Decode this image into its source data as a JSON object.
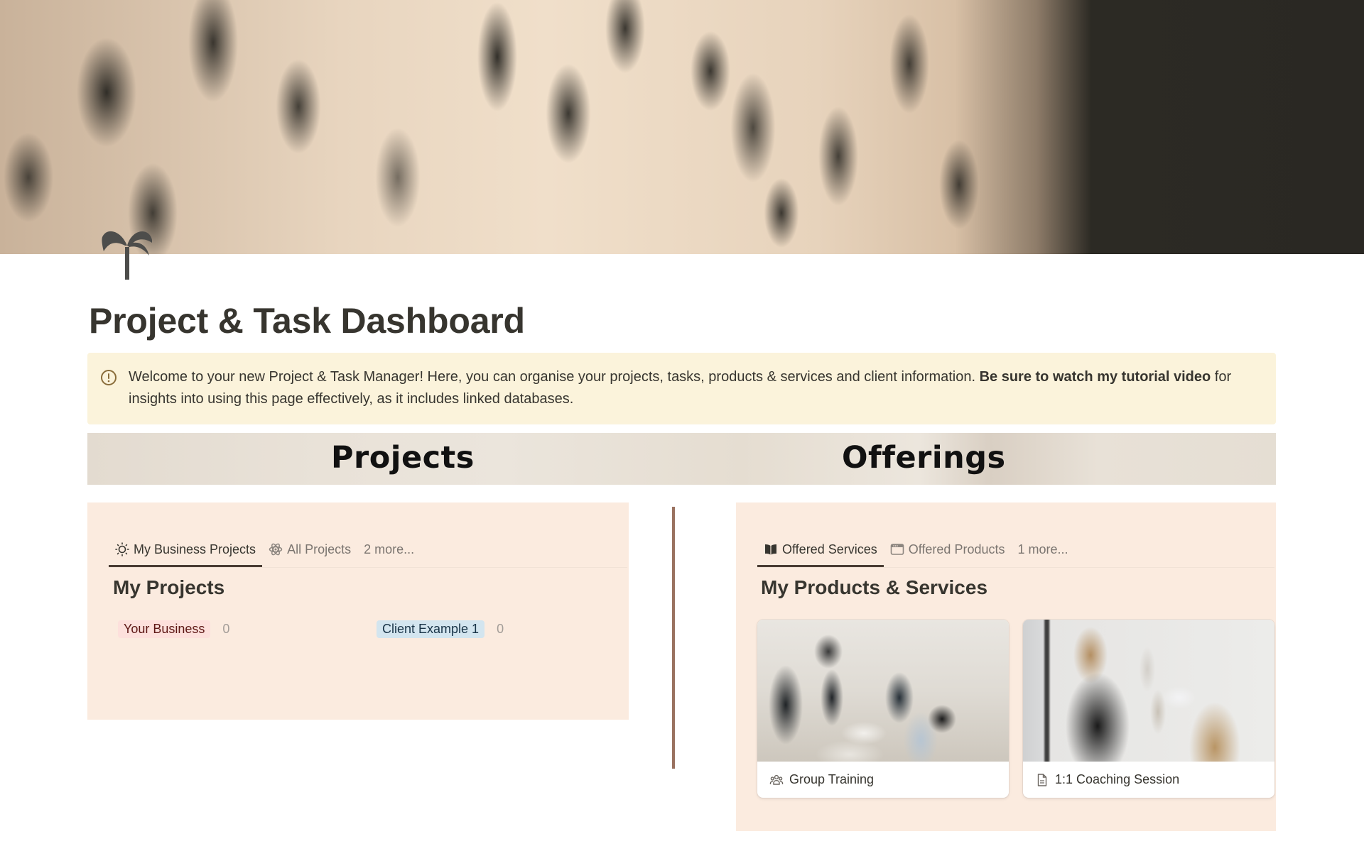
{
  "page": {
    "title": "Project & Task Dashboard",
    "icon": "palm-tree-icon"
  },
  "callout": {
    "icon": "alert-circle-icon",
    "text_normal_1": "Welcome to your new Project & Task Manager! Here, you can organise your projects, tasks, products & services and client information. ",
    "text_bold": "Be sure to watch my tutorial video",
    "text_normal_2": " for insights into using this page effectively, as it includes linked databases."
  },
  "banner": {
    "left_label": "Projects",
    "right_label": "Offerings"
  },
  "projects": {
    "tabs": [
      {
        "label": "My Business Projects",
        "icon": "sun-icon",
        "active": true
      },
      {
        "label": "All Projects",
        "icon": "atom-icon",
        "active": false
      },
      {
        "label": "2 more...",
        "icon": "",
        "active": false
      }
    ],
    "section_title": "My Projects",
    "groups": [
      {
        "label": "Your Business",
        "count": "0",
        "color": "#fde0dc"
      },
      {
        "label": "Client Example 1",
        "count": "0",
        "color": "#d3e5ef"
      }
    ]
  },
  "offerings": {
    "tabs": [
      {
        "label": "Offered Services",
        "icon": "book-open-icon",
        "active": true
      },
      {
        "label": "Offered Products",
        "icon": "browser-window-icon",
        "active": false
      },
      {
        "label": "1 more...",
        "icon": "",
        "active": false
      }
    ],
    "section_title": "My Products & Services",
    "cards": [
      {
        "title": "Group Training",
        "icon": "people-group-icon",
        "image": "office-group-photo"
      },
      {
        "title": "1:1 Coaching Session",
        "icon": "document-icon",
        "image": "coaching-wall-photo"
      }
    ]
  },
  "colors": {
    "panel_bg": "#fbebdf",
    "callout_bg": "#fbf3db",
    "divider": "#9a7260",
    "text": "#37352f"
  }
}
